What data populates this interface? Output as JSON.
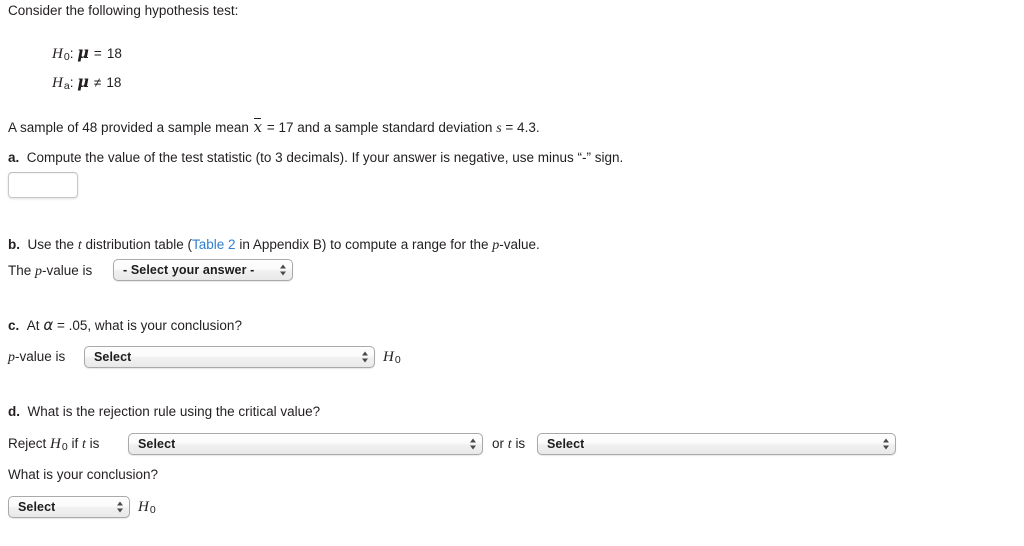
{
  "problem": {
    "intro": "Consider the following hypothesis test:",
    "hypotheses": [
      {
        "symbol": "H",
        "subscript": "0",
        "relation": "=",
        "parameter": "μ",
        "value": "18"
      },
      {
        "symbol": "H",
        "subscript": "a",
        "relation": "≠",
        "parameter": "μ",
        "value": "18"
      }
    ],
    "sample_statement": {
      "prefix": "A sample of 48 provided a sample mean",
      "mean_symbol": "x",
      "mean_equals": "= 17 and a sample standard deviation",
      "sd_symbol": "s",
      "sd_equals": "= 4.3.",
      "sample_size": "48",
      "sample_mean": "17",
      "sample_sd": "4.3"
    }
  },
  "parts": {
    "a": {
      "label": "a.",
      "prompt": "Compute the value of the test statistic (to 3 decimals). If your answer is negative, use minus “-” sign.",
      "answer_value": "",
      "answer_placeholder": ""
    },
    "b": {
      "label": "b.",
      "prompt_before_link": "Use the",
      "prompt_t": "t",
      "prompt_mid": "distribution table (",
      "link_text": "Table 2",
      "prompt_after_link": "in Appendix B) to compute a range for the",
      "prompt_pvalue": "p",
      "prompt_end": "-value.",
      "answer_line_prefix": "The",
      "answer_line_p": "p",
      "answer_line_suffix": "-value is",
      "select_value": "- Select your answer -"
    },
    "c": {
      "label": "c.",
      "prompt_prefix": "At",
      "alpha": "α",
      "prompt_suffix": "= .05, what is your conclusion?",
      "alpha_level": ".05",
      "answer_line_p": "p",
      "answer_line_prefix": "-value is",
      "select_value": "Select",
      "trailing_symbol": "H",
      "trailing_subscript": "0"
    },
    "d": {
      "label": "d.",
      "prompt": "What is the rejection rule using the critical value?",
      "rule_prefix": "Reject",
      "rule_h": "H",
      "rule_h_sub": "0",
      "rule_if": "if",
      "rule_t": "t",
      "rule_is": "is",
      "select1_value": "Select",
      "conjunction_or": "or",
      "conjunction_t": "t",
      "conjunction_is": "is",
      "select2_value": "Select",
      "conclusion_prompt": "What is your conclusion?",
      "conclusion_select_value": "Select",
      "conclusion_trailing_symbol": "H",
      "conclusion_trailing_subscript": "0"
    }
  },
  "colors": {
    "text": "#231f20",
    "link": "#2d7fd0",
    "control_border": "#a9a9a9",
    "page_background": "#ffffff"
  }
}
